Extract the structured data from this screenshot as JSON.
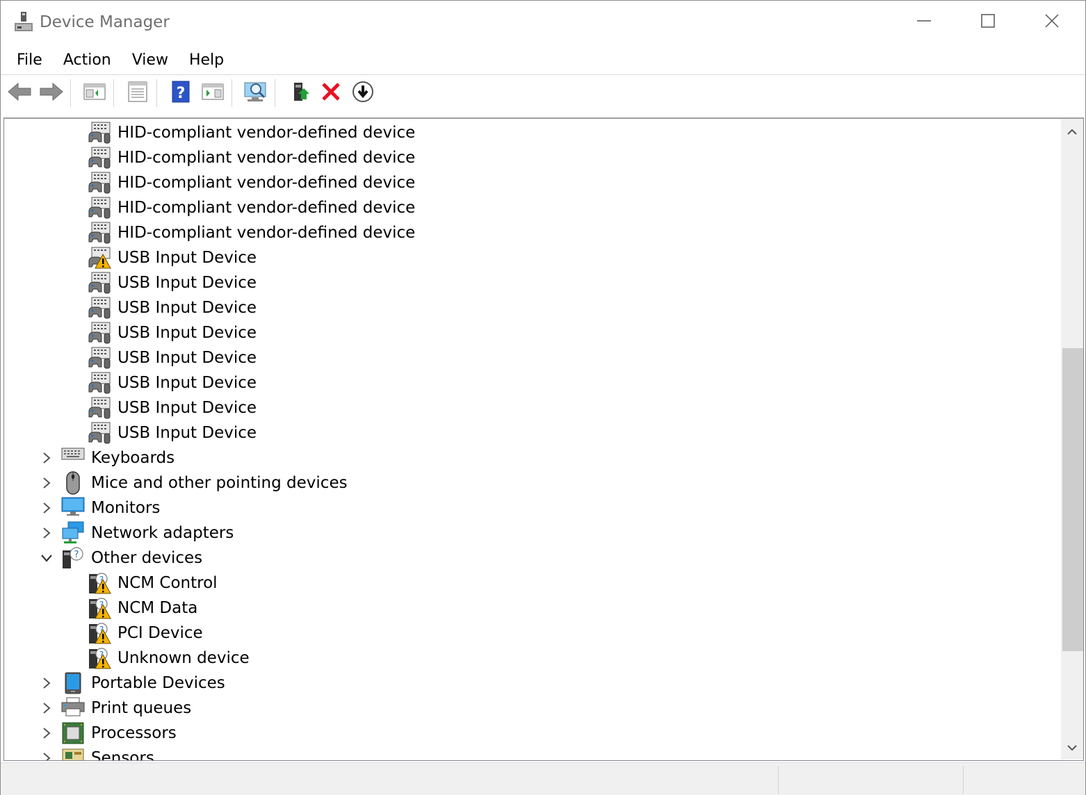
{
  "window": {
    "title": "Device Manager"
  },
  "menu": {
    "items": [
      "File",
      "Action",
      "View",
      "Help"
    ]
  },
  "toolbar": {
    "buttons": [
      "back-icon",
      "forward-icon",
      "show-hide-console-tree-icon",
      "properties-icon",
      "help-icon",
      "action-pane-icon",
      "scan-hardware-icon",
      "update-driver-icon",
      "uninstall-device-icon",
      "enable-device-icon"
    ]
  },
  "colors": {
    "accent": "#1e72c8",
    "warning": "#f5b400",
    "uninstall_red": "#e81123",
    "scroll_thumb": "#cdcdcd"
  },
  "tree": {
    "rows": [
      {
        "label": "HID-compliant vendor-defined device",
        "icon": "hid-device-icon",
        "level": 2
      },
      {
        "label": "HID-compliant vendor-defined device",
        "icon": "hid-device-icon",
        "level": 2
      },
      {
        "label": "HID-compliant vendor-defined device",
        "icon": "hid-device-icon",
        "level": 2
      },
      {
        "label": "HID-compliant vendor-defined device",
        "icon": "hid-device-icon",
        "level": 2
      },
      {
        "label": "HID-compliant vendor-defined device",
        "icon": "hid-device-icon",
        "level": 2
      },
      {
        "label": "USB Input Device",
        "icon": "hid-device-warning-icon",
        "level": 2
      },
      {
        "label": "USB Input Device",
        "icon": "hid-device-icon",
        "level": 2
      },
      {
        "label": "USB Input Device",
        "icon": "hid-device-icon",
        "level": 2
      },
      {
        "label": "USB Input Device",
        "icon": "hid-device-icon",
        "level": 2
      },
      {
        "label": "USB Input Device",
        "icon": "hid-device-icon",
        "level": 2
      },
      {
        "label": "USB Input Device",
        "icon": "hid-device-icon",
        "level": 2
      },
      {
        "label": "USB Input Device",
        "icon": "hid-device-icon",
        "level": 2
      },
      {
        "label": "USB Input Device",
        "icon": "hid-device-icon",
        "level": 2
      },
      {
        "label": "Keyboards",
        "icon": "keyboard-icon",
        "level": 1,
        "expander": "collapsed"
      },
      {
        "label": "Mice and other pointing devices",
        "icon": "mouse-icon",
        "level": 1,
        "expander": "collapsed"
      },
      {
        "label": "Monitors",
        "icon": "monitor-icon",
        "level": 1,
        "expander": "collapsed"
      },
      {
        "label": "Network adapters",
        "icon": "network-adapter-icon",
        "level": 1,
        "expander": "collapsed"
      },
      {
        "label": "Other devices",
        "icon": "other-devices-icon",
        "level": 1,
        "expander": "expanded"
      },
      {
        "label": "NCM Control",
        "icon": "unknown-device-warning-icon",
        "level": 2
      },
      {
        "label": "NCM Data",
        "icon": "unknown-device-warning-icon",
        "level": 2
      },
      {
        "label": "PCI Device",
        "icon": "unknown-device-warning-icon",
        "level": 2
      },
      {
        "label": "Unknown device",
        "icon": "unknown-device-warning-icon",
        "level": 2
      },
      {
        "label": "Portable Devices",
        "icon": "portable-device-icon",
        "level": 1,
        "expander": "collapsed"
      },
      {
        "label": "Print queues",
        "icon": "printer-icon",
        "level": 1,
        "expander": "collapsed"
      },
      {
        "label": "Processors",
        "icon": "processor-icon",
        "level": 1,
        "expander": "collapsed"
      },
      {
        "label": "Sensors",
        "icon": "sensor-icon",
        "level": 1,
        "expander": "collapsed"
      }
    ]
  }
}
